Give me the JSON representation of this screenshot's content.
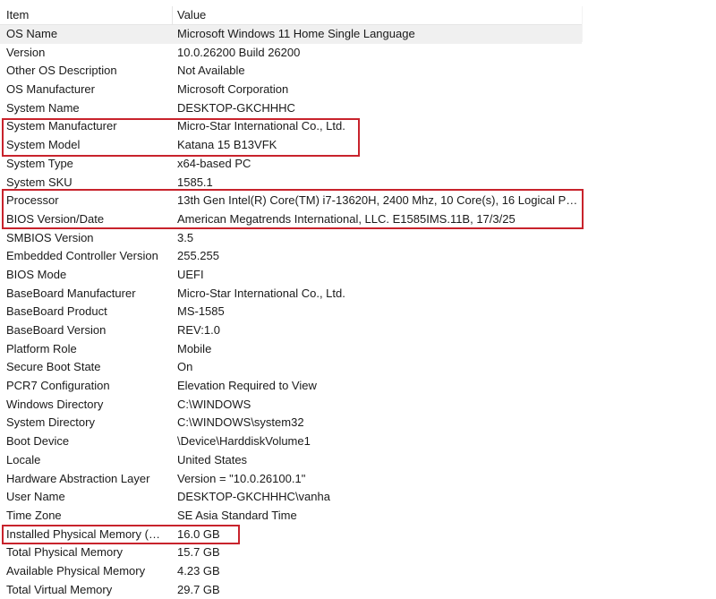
{
  "columns": {
    "item": "Item",
    "value": "Value"
  },
  "rows": [
    {
      "item": "OS Name",
      "value": "Microsoft Windows 11 Home Single Language"
    },
    {
      "item": "Version",
      "value": "10.0.26200 Build 26200"
    },
    {
      "item": "Other OS Description",
      "value": "Not Available"
    },
    {
      "item": "OS Manufacturer",
      "value": "Microsoft Corporation"
    },
    {
      "item": "System Name",
      "value": "DESKTOP-GKCHHHC"
    },
    {
      "item": "System Manufacturer",
      "value": "Micro-Star International Co., Ltd."
    },
    {
      "item": "System Model",
      "value": "Katana 15 B13VFK"
    },
    {
      "item": "System Type",
      "value": "x64-based PC"
    },
    {
      "item": "System SKU",
      "value": "1585.1"
    },
    {
      "item": "Processor",
      "value": "13th Gen Intel(R) Core(TM) i7-13620H, 2400 Mhz, 10 Core(s), 16 Logical Pro..."
    },
    {
      "item": "BIOS Version/Date",
      "value": "American Megatrends International, LLC. E1585IMS.11B, 17/3/25"
    },
    {
      "item": "SMBIOS Version",
      "value": "3.5"
    },
    {
      "item": "Embedded Controller Version",
      "value": "255.255"
    },
    {
      "item": "BIOS Mode",
      "value": "UEFI"
    },
    {
      "item": "BaseBoard Manufacturer",
      "value": "Micro-Star International Co., Ltd."
    },
    {
      "item": "BaseBoard Product",
      "value": "MS-1585"
    },
    {
      "item": "BaseBoard Version",
      "value": "REV:1.0"
    },
    {
      "item": "Platform Role",
      "value": "Mobile"
    },
    {
      "item": "Secure Boot State",
      "value": "On"
    },
    {
      "item": "PCR7 Configuration",
      "value": "Elevation Required to View"
    },
    {
      "item": "Windows Directory",
      "value": "C:\\WINDOWS"
    },
    {
      "item": "System Directory",
      "value": "C:\\WINDOWS\\system32"
    },
    {
      "item": "Boot Device",
      "value": "\\Device\\HarddiskVolume1"
    },
    {
      "item": "Locale",
      "value": "United States"
    },
    {
      "item": "Hardware Abstraction Layer",
      "value": "Version = \"10.0.26100.1\""
    },
    {
      "item": "User Name",
      "value": "DESKTOP-GKCHHHC\\vanha"
    },
    {
      "item": "Time Zone",
      "value": "SE Asia Standard Time"
    },
    {
      "item": "Installed Physical Memory (RA...",
      "value": "16.0 GB"
    },
    {
      "item": "Total Physical Memory",
      "value": "15.7 GB"
    },
    {
      "item": "Available Physical Memory",
      "value": "4.23 GB"
    },
    {
      "item": "Total Virtual Memory",
      "value": "29.7 GB"
    }
  ],
  "annotation_color": "#c8232c",
  "selection_color": "#f0f0f0"
}
